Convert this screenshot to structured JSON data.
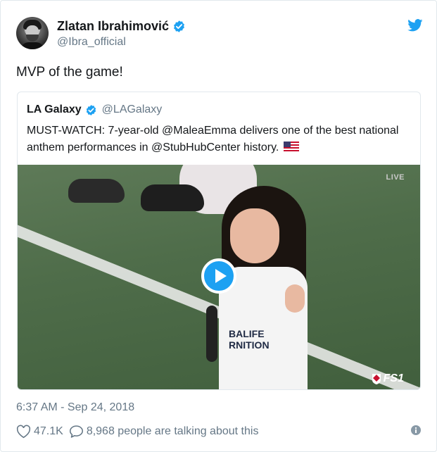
{
  "tweet": {
    "author": {
      "display_name": "Zlatan Ibrahimović",
      "handle": "@Ibra_official",
      "avatar_icon": "user-avatar"
    },
    "text": "MVP of the game!",
    "timestamp": "6:37 AM - Sep 24, 2018",
    "likes": "47.1K",
    "replies_text": "8,968 people are talking about this"
  },
  "quoted_tweet": {
    "display_name": "LA Galaxy",
    "handle": "@LAGalaxy",
    "text": "MUST-WATCH: 7-year-old @MaleaEmma delivers one of the best national anthem performances in @StubHubCenter history.",
    "flag_icon": "us-flag-emoji",
    "video": {
      "live_label": "LIVE",
      "network_label": "FS1",
      "jersey_text": "BALIFE RNITION"
    }
  },
  "icons": {
    "verified": "verified-badge-icon",
    "twitter": "twitter-bird-icon",
    "play": "play-icon",
    "like": "heart-icon",
    "reply": "reply-bubble-icon",
    "info": "info-icon"
  },
  "colors": {
    "accent": "#1da1f2",
    "text": "#14171a",
    "secondary_text": "#657786",
    "border": "#e1e8ed"
  }
}
